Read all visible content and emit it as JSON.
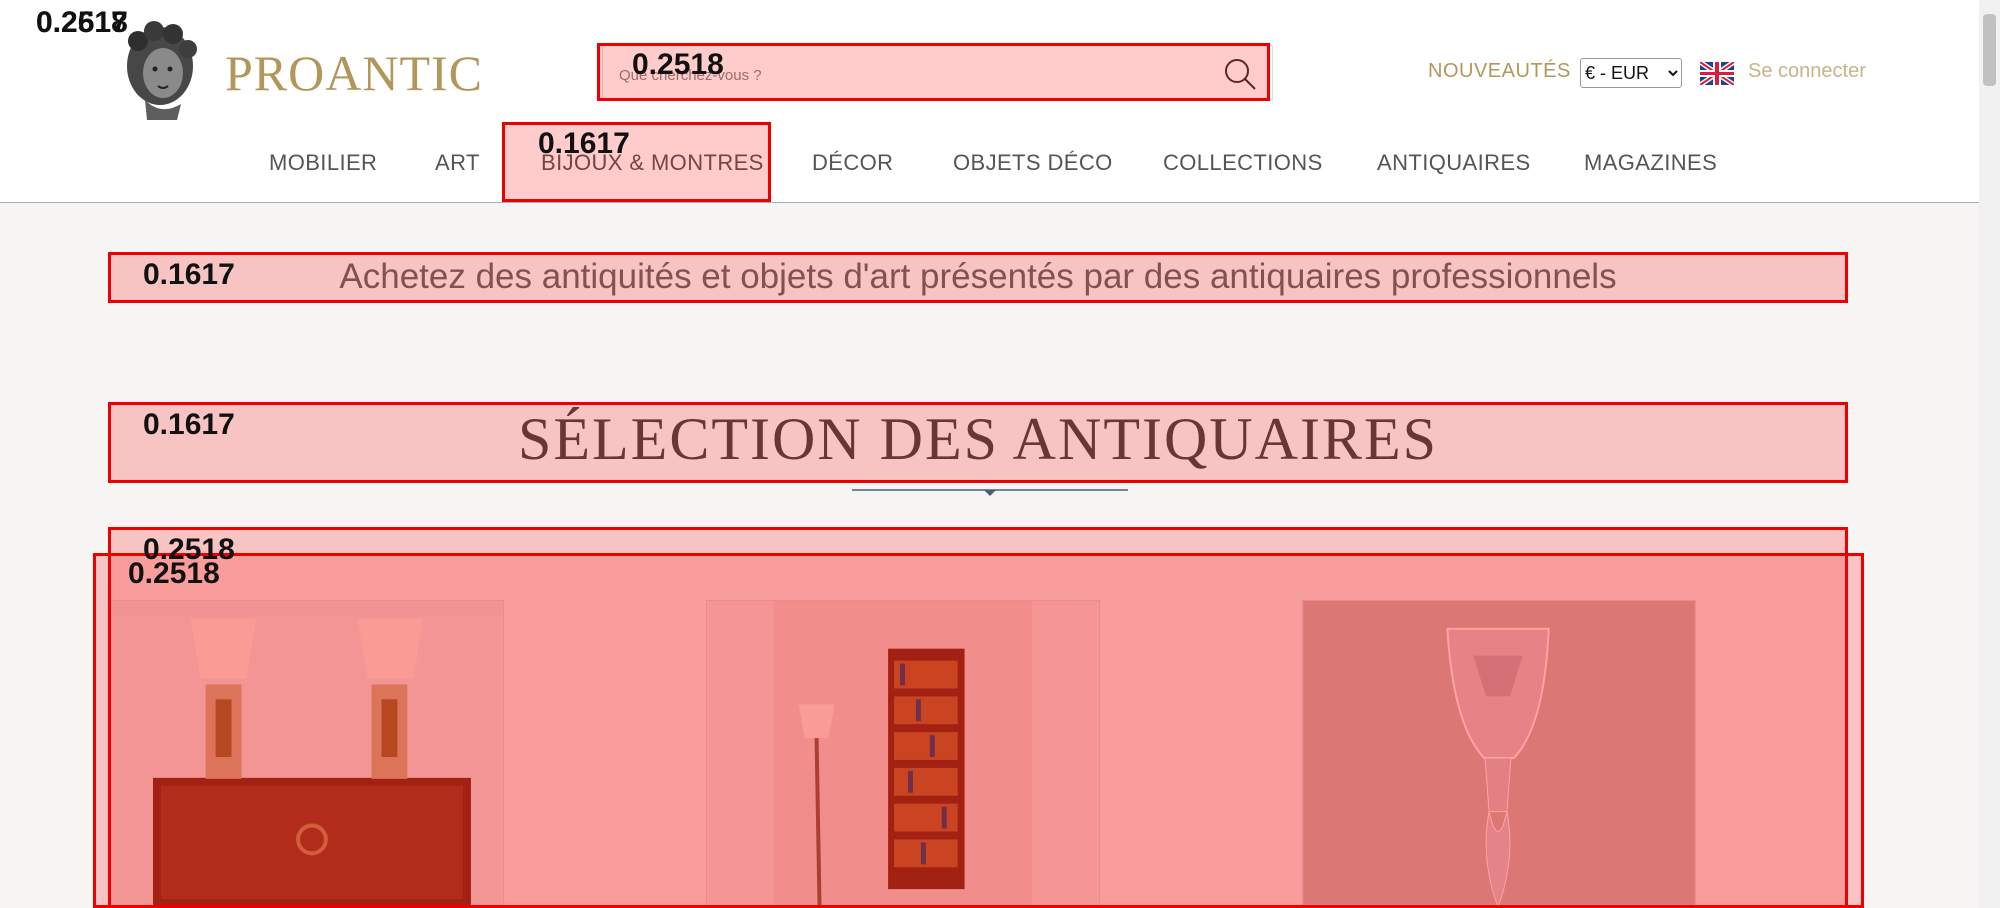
{
  "header": {
    "logo_text": "PROANTIC",
    "search": {
      "placeholder": "Que cherchez-vous ?"
    },
    "news_link": "NOUVEAUTÉS",
    "currency": "€ - EUR",
    "login": "Se connecter"
  },
  "nav": {
    "items": [
      {
        "label": "MOBILIER"
      },
      {
        "label": "ART"
      },
      {
        "label": "BIJOUX & MONTRES"
      },
      {
        "label": "DÉCOR"
      },
      {
        "label": "OBJETS DÉCO"
      },
      {
        "label": "COLLECTIONS"
      },
      {
        "label": "ANTIQUAIRES"
      },
      {
        "label": "MAGAZINES"
      }
    ]
  },
  "hero": {
    "tagline": "Achetez des antiquités et objets d'art présentés par des antiquaires professionnels",
    "section_title": "SÉLECTION DES ANTIQUAIRES"
  },
  "overlay_labels": {
    "corner_a": "0.2617",
    "corner_b": "0.2518",
    "search": "0.2518",
    "nav_jewelry": "0.1617",
    "tagline": "0.1617",
    "title": "0.1617",
    "products_outer": "0.2518",
    "products_inner": "0.2518"
  },
  "icons": {
    "search": "search-icon",
    "flag": "uk-flag-icon",
    "logo": "bust-logo-icon"
  },
  "colors": {
    "brand_gold": "#b3965a",
    "overlay_red": "#ff0000",
    "nav_text": "#555555"
  }
}
